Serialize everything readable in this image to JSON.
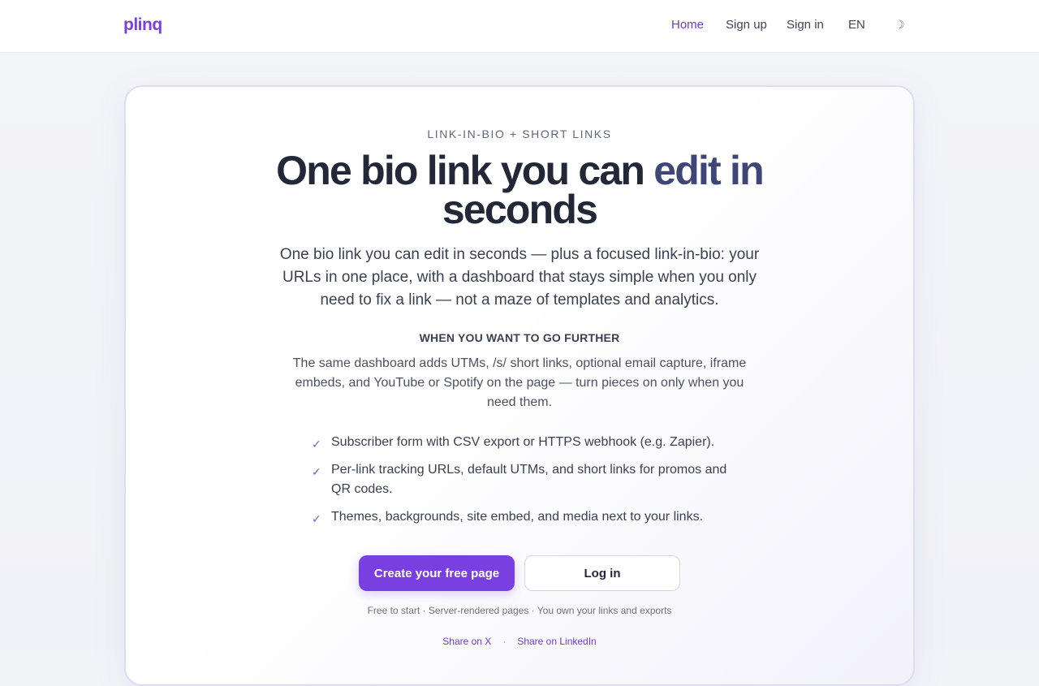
{
  "brand": {
    "logo": "plinq",
    "accent_color": "#7a3fe0"
  },
  "nav": {
    "home": "Home",
    "signup": "Sign up",
    "signin": "Sign in",
    "language": "EN",
    "theme_toggle_icon": "moon-icon",
    "theme_toggle_glyph": "☽"
  },
  "hero": {
    "eyebrow": "LINK-IN-BIO + SHORT LINKS",
    "headline_part1": "One bio link you can ",
    "headline_accent": "edit in",
    "headline_line2": "seconds",
    "subtitle": "One bio link you can edit in seconds — plus a focused link-in-bio: your URLs in one place, with a dashboard that stays simple when you only need to fix a link — not a maze of templates and analytics.",
    "further_heading": "WHEN YOU WANT TO GO FURTHER",
    "further_text": "The same dashboard adds UTMs, /s/ short links, optional email capture, iframe embeds, and YouTube or Spotify on the page — turn pieces on only when you need them.",
    "features": [
      "Subscriber form with CSV export or HTTPS webhook (e.g. Zapier).",
      "Per-link tracking URLs, default UTMs, and short links for promos and QR codes.",
      "Themes, backgrounds, site embed, and media next to your links."
    ],
    "check_glyph": "✓",
    "cta_primary": "Create your free page",
    "cta_secondary": "Log in",
    "footnote": "Free to start · Server-rendered pages · You own your links and exports",
    "share_x": "Share on X",
    "share_separator": "·",
    "share_linkedin": "Share on LinkedIn"
  }
}
